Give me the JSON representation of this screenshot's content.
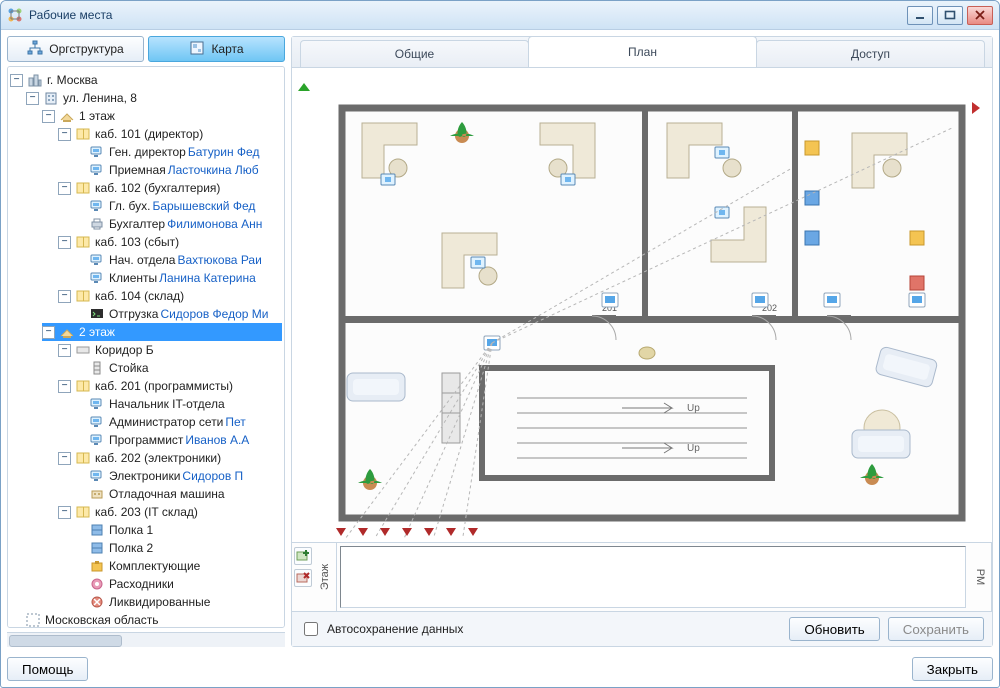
{
  "window": {
    "title": "Рабочие места"
  },
  "left": {
    "toggles": {
      "org": "Оргструктура",
      "map": "Карта",
      "active": "map"
    },
    "tree": [
      {
        "label": "г. Москва",
        "icon": "city",
        "expanded": true,
        "children": [
          {
            "label": "ул. Ленина, 8",
            "icon": "building",
            "expanded": true,
            "children": [
              {
                "label": "1 этаж",
                "icon": "floor",
                "expanded": true,
                "children": [
                  {
                    "label": "каб. 101 (директор)",
                    "icon": "room",
                    "expanded": true,
                    "children": [
                      {
                        "label": "Ген. директор ",
                        "person": "Батурин Фед",
                        "icon": "pc"
                      },
                      {
                        "label": "Приемная ",
                        "person": "Ласточкина Люб",
                        "icon": "pc"
                      }
                    ]
                  },
                  {
                    "label": "каб. 102 (бухгалтерия)",
                    "icon": "room",
                    "expanded": true,
                    "children": [
                      {
                        "label": "Гл. бух. ",
                        "person": "Барышевский Фед",
                        "icon": "pc"
                      },
                      {
                        "label": "Бухгалтер ",
                        "person": "Филимонова Анн",
                        "icon": "printer"
                      }
                    ]
                  },
                  {
                    "label": "каб. 103 (сбыт)",
                    "icon": "room",
                    "expanded": true,
                    "children": [
                      {
                        "label": "Нач. отдела ",
                        "person": "Вахтюкова Раи",
                        "icon": "pc"
                      },
                      {
                        "label": "Клиенты ",
                        "person": "Ланина Катерина",
                        "icon": "pc"
                      }
                    ]
                  },
                  {
                    "label": "каб. 104 (склад)",
                    "icon": "room",
                    "expanded": true,
                    "children": [
                      {
                        "label": "Отгрузка ",
                        "person": "Сидоров Федор Ми",
                        "icon": "terminal"
                      }
                    ]
                  }
                ]
              },
              {
                "label": "2 этаж",
                "icon": "floor",
                "expanded": true,
                "selected": true,
                "children": [
                  {
                    "label": "Коридор Б",
                    "icon": "corridor",
                    "expanded": true,
                    "children": [
                      {
                        "label": "Стойка",
                        "icon": "rack"
                      }
                    ]
                  },
                  {
                    "label": "каб. 201 (программисты)",
                    "icon": "room",
                    "expanded": true,
                    "children": [
                      {
                        "label": "Начальник IT-отдела",
                        "icon": "pc"
                      },
                      {
                        "label": "Администратор сети ",
                        "person": "Пет",
                        "icon": "pc"
                      },
                      {
                        "label": "Программист ",
                        "person": "Иванов А.А",
                        "icon": "pc"
                      }
                    ]
                  },
                  {
                    "label": "каб. 202 (электроники)",
                    "icon": "room",
                    "expanded": true,
                    "children": [
                      {
                        "label": "Электроники ",
                        "person": "Сидоров П",
                        "icon": "pc"
                      },
                      {
                        "label": "Отладочная машина",
                        "icon": "debug"
                      }
                    ]
                  },
                  {
                    "label": "каб. 203 (IT склад)",
                    "icon": "room",
                    "expanded": true,
                    "children": [
                      {
                        "label": "Полка 1",
                        "icon": "shelf"
                      },
                      {
                        "label": "Полка 2",
                        "icon": "shelf"
                      },
                      {
                        "label": "Комплектующие",
                        "icon": "parts"
                      },
                      {
                        "label": "Расходники",
                        "icon": "supply"
                      },
                      {
                        "label": "Ликвидированные",
                        "icon": "trash"
                      }
                    ]
                  }
                ]
              }
            ]
          }
        ]
      },
      {
        "label": "Московская область",
        "icon": "region",
        "expanded": false
      }
    ]
  },
  "tabs": {
    "items": [
      "Общие",
      "План",
      "Доступ"
    ],
    "active": 1
  },
  "plan": {
    "rooms": {
      "201": "201",
      "202": "202",
      "203": ""
    },
    "stairs": {
      "up1": "Up",
      "up2": "Up"
    }
  },
  "mini": {
    "left_label": "Этаж",
    "right_label": "РМ"
  },
  "footer": {
    "autosave": "Автосохранение данных",
    "refresh": "Обновить",
    "save": "Сохранить",
    "help": "Помощь",
    "close": "Закрыть"
  },
  "icons": {
    "org": "org-icon",
    "map": "map-icon"
  }
}
